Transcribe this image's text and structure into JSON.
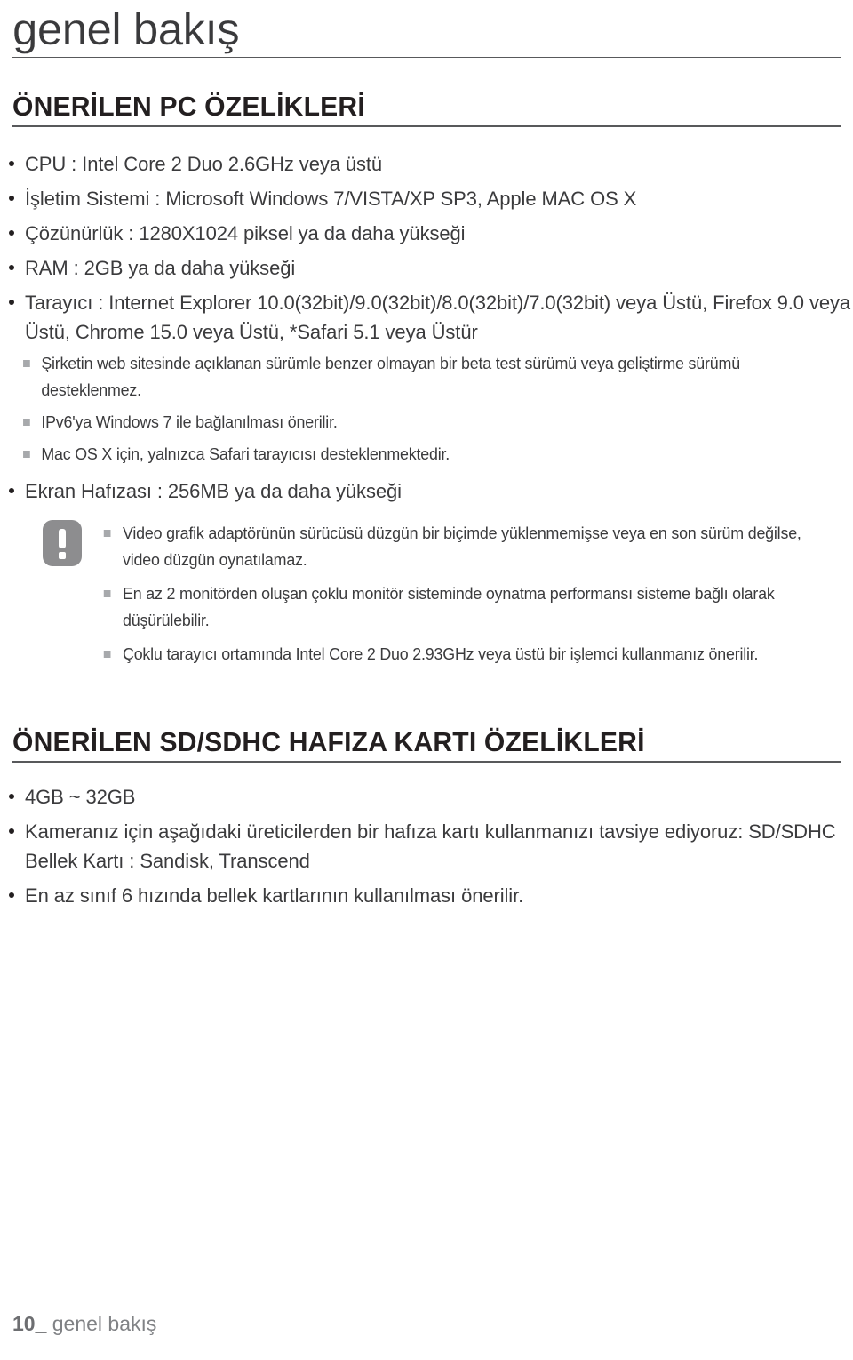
{
  "running_head": "genel bakış",
  "sections": [
    {
      "heading": "ÖNERİLEN PC ÖZELİKLERİ",
      "bullets": [
        "CPU : Intel Core 2 Duo 2.6GHz veya üstü",
        "İşletim Sistemi : Microsoft Windows 7/VISTA/XP SP3, Apple MAC OS X",
        "Çözünürlük : 1280X1024 piksel ya da daha yükseği",
        "RAM : 2GB ya da daha yükseği",
        "Tarayıcı : Internet Explorer 10.0(32bit)/9.0(32bit)/8.0(32bit)/7.0(32bit) veya Üstü, Firefox 9.0 veya Üstü, Chrome 15.0 veya Üstü, *Safari 5.1 veya Üstür"
      ],
      "sub_bullets": [
        "Şirketin web sitesinde açıklanan sürümle benzer olmayan bir beta test sürümü veya geliştirme sürümü desteklenmez.",
        "IPv6'ya Windows 7 ile bağlanılması önerilir.",
        "Mac OS X için, yalnızca Safari tarayıcısı desteklenmektedir."
      ],
      "bullet_after": "Ekran Hafızası : 256MB ya da daha yükseği",
      "note": {
        "icon": "caution-exclamation-icon",
        "items": [
          "Video grafik adaptörünün sürücüsü düzgün bir biçimde yüklenmemişse veya en son sürüm değilse, video düzgün oynatılamaz.",
          "En az 2 monitörden oluşan çoklu monitör sisteminde oynatma performansı sisteme bağlı olarak düşürülebilir.",
          "Çoklu tarayıcı ortamında Intel Core 2 Duo 2.93GHz veya üstü bir işlemci kullanmanız önerilir."
        ]
      }
    },
    {
      "heading": "ÖNERİLEN SD/SDHC HAFIZA KARTI ÖZELİKLERİ",
      "bullets": [
        "4GB ~ 32GB",
        "Kameranız için aşağıdaki üreticilerden bir hafıza kartı kullanmanızı tavsiye ediyoruz: SD/SDHC Bellek Kartı : Sandisk, Transcend",
        "En az sınıf 6 hızında bellek kartlarının kullanılması önerilir."
      ]
    }
  ],
  "footer": {
    "page_number": "10_",
    "label": "genel bakış"
  },
  "colors": {
    "text": "#3b3b3d",
    "heading": "#231f20",
    "rule": "#58595b",
    "sub_bullet": "#a7a9ac",
    "note_icon_bg": "#8d8d8f",
    "footer": "#808285"
  }
}
